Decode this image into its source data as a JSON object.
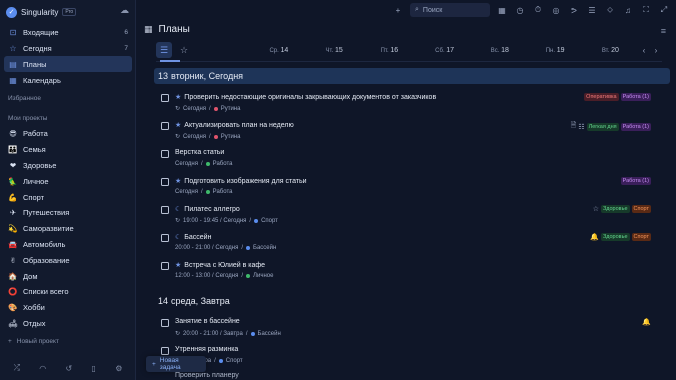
{
  "app": {
    "name": "Singularity",
    "badge": "Pro"
  },
  "sidebar": {
    "nav": [
      {
        "label": "Входящие",
        "count": "6",
        "icon": "inbox-icon",
        "glyph": "⊡"
      },
      {
        "label": "Сегодня",
        "count": "7",
        "icon": "star-icon",
        "glyph": "☆"
      },
      {
        "label": "Планы",
        "count": "",
        "icon": "plans-icon",
        "glyph": "▤",
        "active": true
      },
      {
        "label": "Календарь",
        "count": "",
        "icon": "calendar-icon",
        "glyph": "▦"
      }
    ],
    "favorites_label": "Избранное",
    "projects_label": "Мои проекты",
    "projects": [
      {
        "label": "Работа",
        "emoji": "😎"
      },
      {
        "label": "Семья",
        "emoji": "👪"
      },
      {
        "label": "Здоровье",
        "emoji": "❤"
      },
      {
        "label": "Личное",
        "emoji": "🦜"
      },
      {
        "label": "Спорт",
        "emoji": "💪"
      },
      {
        "label": "Путешествия",
        "emoji": "✈"
      },
      {
        "label": "Саморазвитие",
        "emoji": "💫"
      },
      {
        "label": "Автомобиль",
        "emoji": "🚘"
      },
      {
        "label": "Образование",
        "emoji": "✌"
      },
      {
        "label": "Дом",
        "emoji": "🏠"
      },
      {
        "label": "Списки всего",
        "emoji": "⭕"
      },
      {
        "label": "Хобби",
        "emoji": "🎨"
      },
      {
        "label": "Отдых",
        "emoji": "🛋"
      }
    ],
    "new_project": "Новый проект"
  },
  "topbar": {
    "search_placeholder": "Поиск"
  },
  "page": {
    "title": "Планы"
  },
  "day_tabs": [
    {
      "wd": "Ср.",
      "d": "14"
    },
    {
      "wd": "Чт.",
      "d": "15"
    },
    {
      "wd": "Пт.",
      "d": "16"
    },
    {
      "wd": "Сб.",
      "d": "17"
    },
    {
      "wd": "Вс.",
      "d": "18"
    },
    {
      "wd": "Пн.",
      "d": "19"
    },
    {
      "wd": "Вт.",
      "d": "20"
    }
  ],
  "days": [
    {
      "num": "13",
      "label": "вторник, Сегодня",
      "tasks": [
        {
          "title": "Проверить недостающие оригиналы закрывающих документов от заказчиков",
          "prefix": "star",
          "meta_icon": "↻",
          "meta": "Сегодня",
          "project": "Рутина",
          "project_color": "#e0546c",
          "tags": [
            {
              "text": "Оперативка",
              "color": "red"
            },
            {
              "text": "Работа (1)",
              "color": "purple"
            }
          ]
        },
        {
          "title": "Актуализировать план на неделю",
          "prefix": "star",
          "meta_icon": "↻",
          "meta": "Сегодня",
          "project": "Рутина",
          "project_color": "#e0546c",
          "icons": [
            "doc",
            "list"
          ],
          "tags": [
            {
              "text": "Легкая дня",
              "color": "green"
            },
            {
              "text": "Работа (1)",
              "color": "purple"
            }
          ]
        },
        {
          "title": "Верстка статьи",
          "prefix": "",
          "meta_icon": "",
          "meta": "Сегодня",
          "project": "Работа",
          "project_color": "#3fb96b",
          "tags": []
        },
        {
          "title": "Подготовить изображения для статьи",
          "prefix": "star",
          "meta_icon": "",
          "meta": "Сегодня",
          "project": "Работа",
          "project_color": "#3fb96b",
          "tags": [
            {
              "text": "Работа (1)",
              "color": "purple"
            }
          ]
        },
        {
          "title": "Пилатес аллегро",
          "prefix": "moon",
          "meta_icon": "↻",
          "meta": "19:00 - 19:45 / Сегодня",
          "project": "Спорт",
          "project_color": "#5b8dee",
          "icons": [
            "badge"
          ],
          "tags": [
            {
              "text": "Здоровье",
              "color": "green"
            },
            {
              "text": "Спорт",
              "color": "orange"
            }
          ]
        },
        {
          "title": "Бассейн",
          "prefix": "moon",
          "meta_icon": "",
          "meta": "20:00 - 21:00 / Сегодня",
          "project": "Бассейн",
          "project_color": "#5b8dee",
          "icons": [
            "bell"
          ],
          "tags": [
            {
              "text": "Здоровье",
              "color": "green"
            },
            {
              "text": "Спорт",
              "color": "orange"
            }
          ]
        },
        {
          "title": "Встреча с Юлией в кафе",
          "prefix": "star",
          "meta_icon": "",
          "meta": "12:00 - 13:00 / Сегодня",
          "project": "Личное",
          "project_color": "#3fb96b",
          "tags": []
        }
      ]
    },
    {
      "num": "14",
      "label": "среда, Завтра",
      "tasks": [
        {
          "title": "Занятие в бассейне",
          "prefix": "",
          "meta_icon": "↻",
          "meta": "20:00 - 21:00 / Завтра",
          "project": "Бассейн",
          "project_color": "#5b8dee",
          "icons": [
            "bell"
          ],
          "tags": []
        },
        {
          "title": "Утренняя разминка",
          "prefix": "",
          "meta_icon": "",
          "meta": "7:30 / Завтра",
          "project": "Спорт",
          "project_color": "#5b8dee",
          "tags": []
        }
      ]
    }
  ],
  "partial_task": "Проверить планеру",
  "new_task_label": "Новая задача"
}
